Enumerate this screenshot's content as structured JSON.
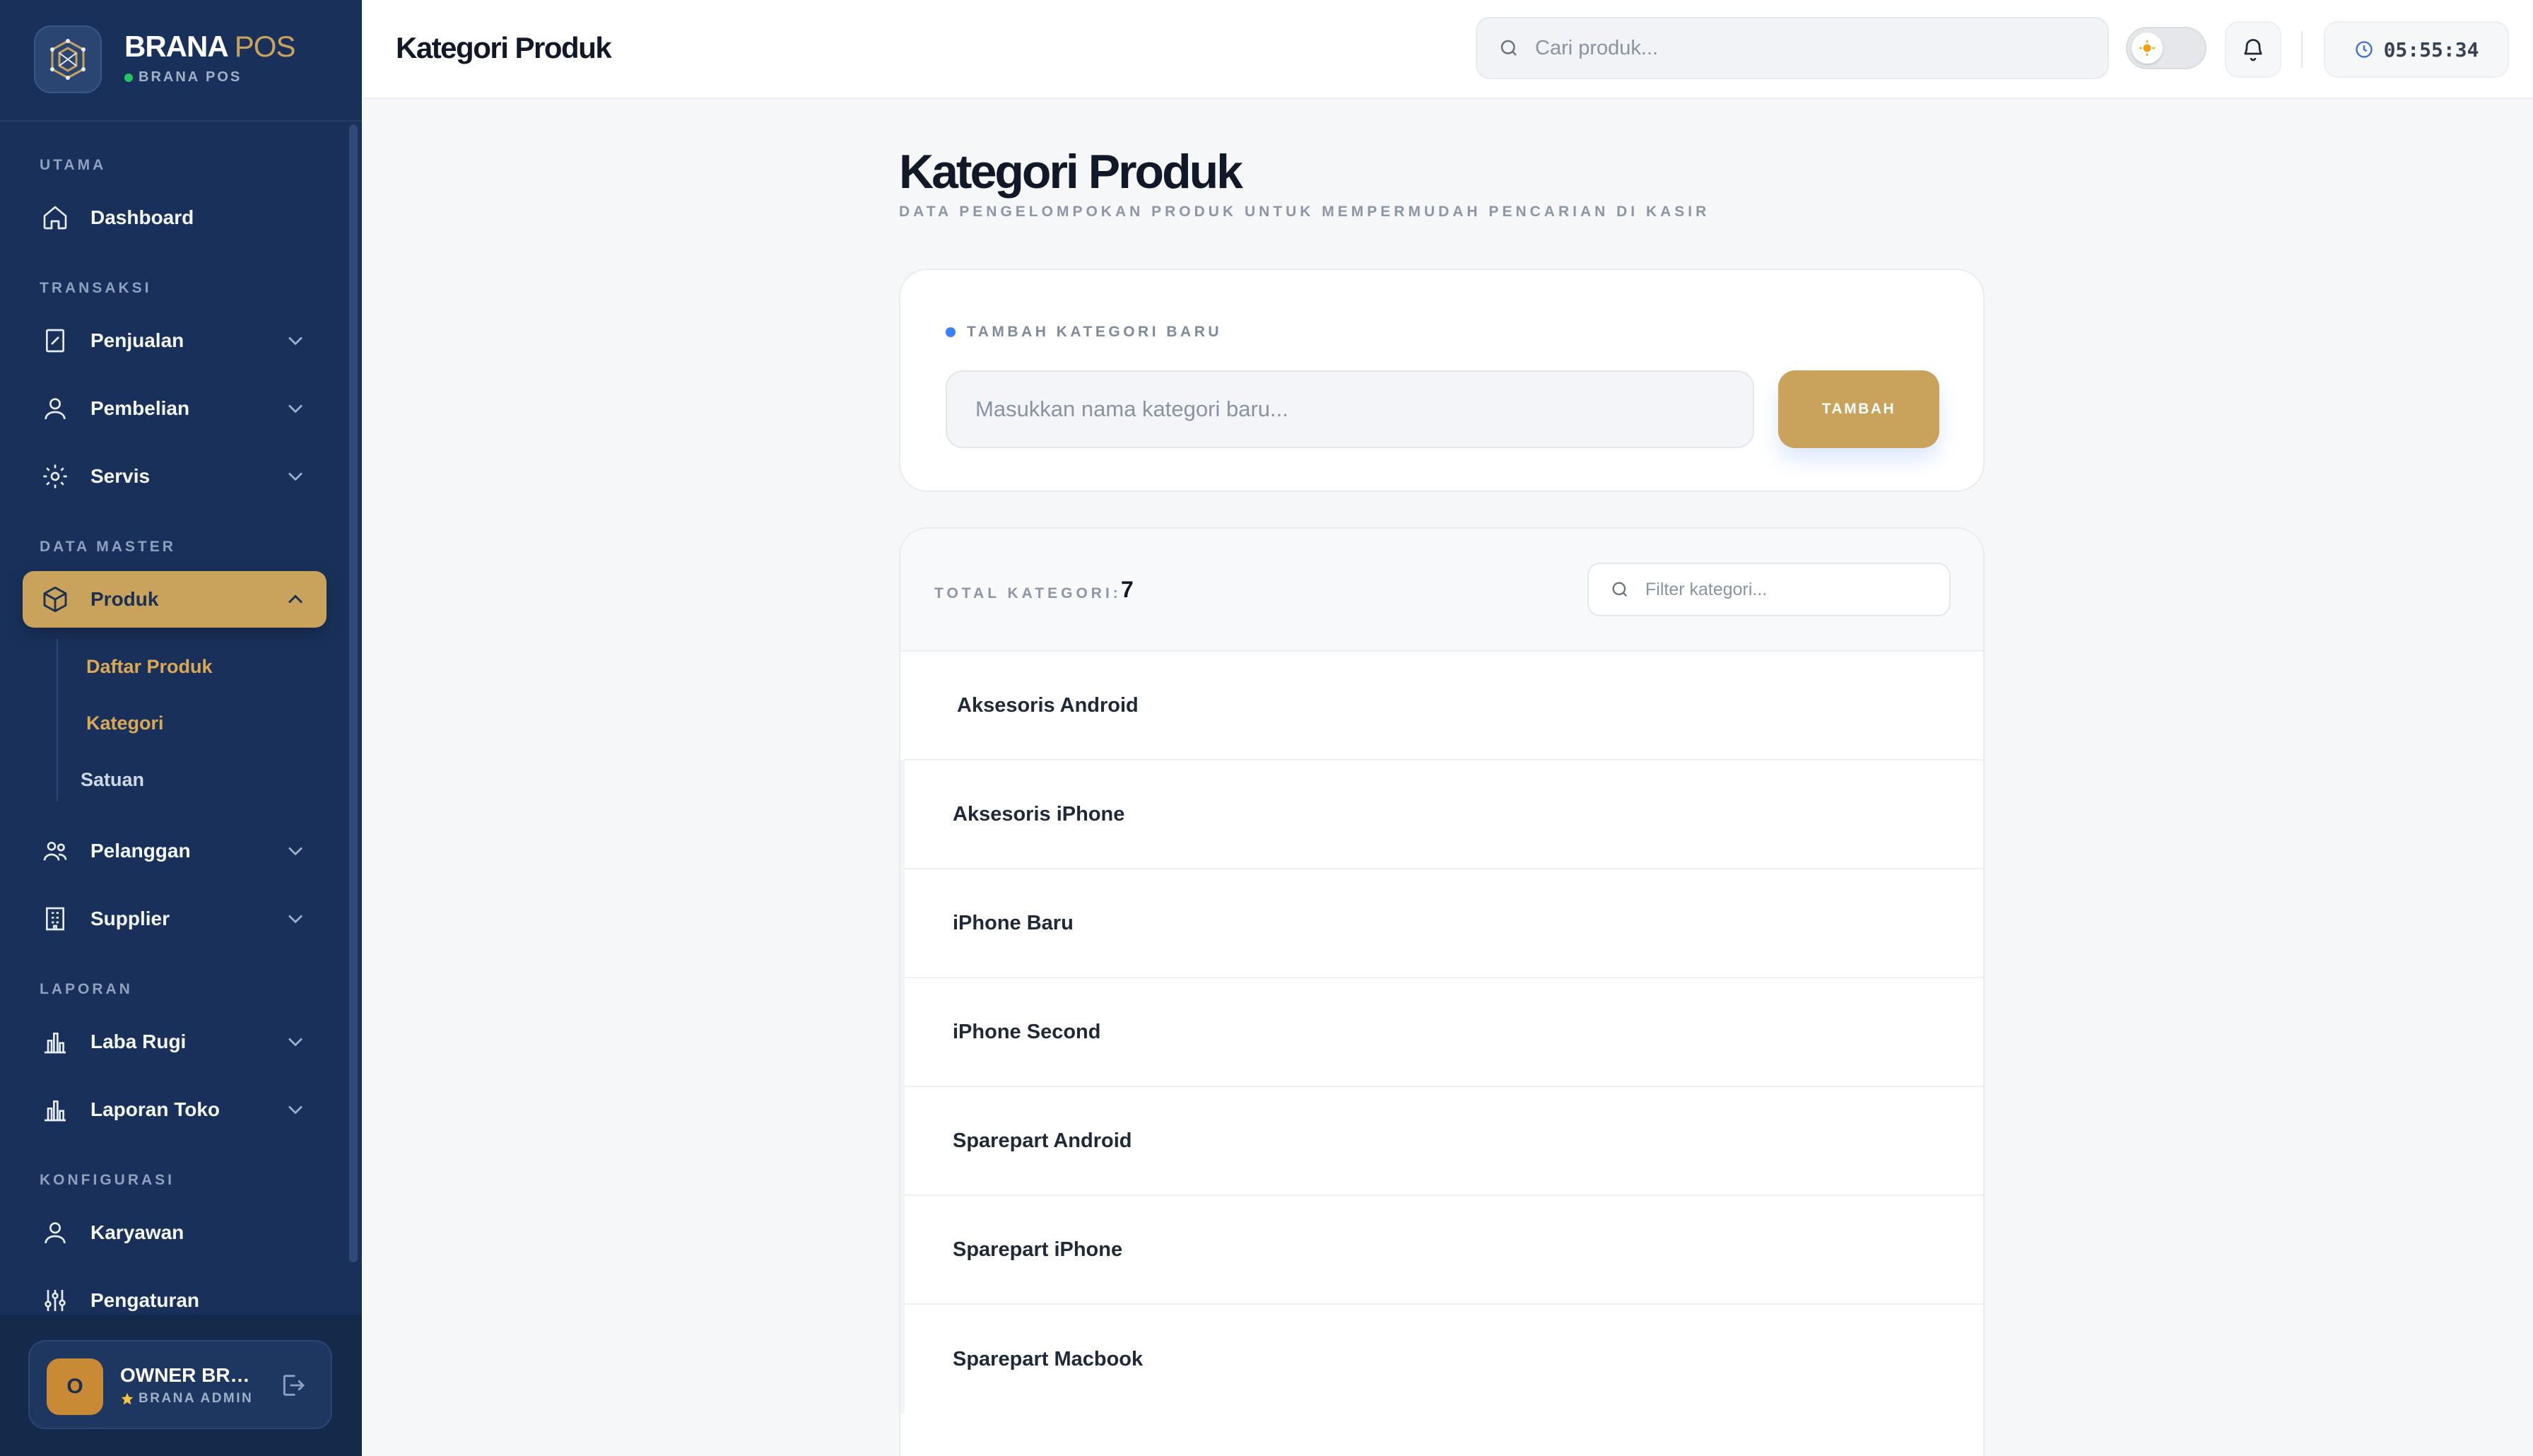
{
  "brand": {
    "name_primary": "BRANA",
    "name_accent": "POS",
    "subtitle": "BRANA POS"
  },
  "sidebar": {
    "sections": {
      "utama": "UTAMA",
      "transaksi": "TRANSAKSI",
      "data_master": "DATA MASTER",
      "laporan": "LAPORAN",
      "konfigurasi": "KONFIGURASI"
    },
    "items": {
      "dashboard": "Dashboard",
      "penjualan": "Penjualan",
      "pembelian": "Pembelian",
      "servis": "Servis",
      "produk": "Produk",
      "pelanggan": "Pelanggan",
      "supplier": "Supplier",
      "laba_rugi": "Laba Rugi",
      "laporan_toko": "Laporan Toko",
      "karyawan": "Karyawan",
      "pengaturan": "Pengaturan"
    },
    "produk_sub": {
      "daftar_produk": "Daftar Produk",
      "kategori": "Kategori",
      "satuan": "Satuan"
    },
    "user": {
      "initial": "O",
      "name": "OWNER BRANA",
      "role": "BRANA ADMIN"
    }
  },
  "topbar": {
    "title": "Kategori Produk",
    "search_placeholder": "Cari produk...",
    "clock": "05:55:34"
  },
  "main": {
    "heading": "Kategori Produk",
    "subtitle": "DATA PENGELOMPOKAN PRODUK UNTUK MEMPERMUDAH PENCARIAN DI KASIR",
    "add_card": {
      "label": "TAMBAH KATEGORI BARU",
      "input_placeholder": "Masukkan nama kategori baru...",
      "button": "TAMBAH"
    },
    "list": {
      "total_label": "TOTAL KATEGORI:",
      "total_value": "7",
      "filter_placeholder": "Filter kategori...",
      "categories": [
        "Aksesoris Android",
        "Aksesoris iPhone",
        "iPhone Baru",
        "iPhone Second",
        "Sparepart Android",
        "Sparepart iPhone",
        "Sparepart Macbook"
      ]
    }
  },
  "colors": {
    "sidebar_bg": "#19315a",
    "accent_gold": "#c9a25b",
    "status_green": "#22c55e",
    "dot_blue": "#3b82f6"
  }
}
